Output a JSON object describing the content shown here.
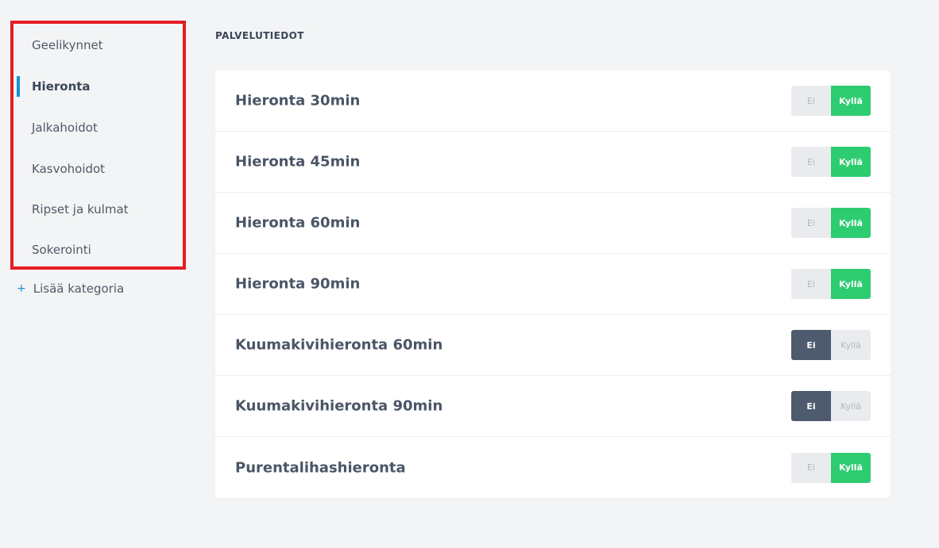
{
  "sidebar": {
    "items": [
      {
        "label": "Geelikynnet",
        "active": false
      },
      {
        "label": "Hieronta",
        "active": true
      },
      {
        "label": "Jalkahoidot",
        "active": false
      },
      {
        "label": "Kasvohoidot",
        "active": false
      },
      {
        "label": "Ripset ja kulmat",
        "active": false
      },
      {
        "label": "Sokerointi",
        "active": false
      }
    ],
    "add_category_label": "Lisää kategoria",
    "add_category_icon": "plus-icon",
    "highlight_color": "#e51c23",
    "active_indicator_color": "#1a90d6"
  },
  "main": {
    "section_title": "PALVELUTIEDOT",
    "toggle_labels": {
      "no": "Ei",
      "yes": "Kyllä"
    },
    "colors": {
      "yes_active": "#2ecc71",
      "no_active": "#4e5a6e",
      "inactive": "#e9ebee"
    },
    "services": [
      {
        "name": "Hieronta 30min",
        "value": "Kyllä"
      },
      {
        "name": "Hieronta 45min",
        "value": "Kyllä"
      },
      {
        "name": "Hieronta 60min",
        "value": "Kyllä"
      },
      {
        "name": "Hieronta 90min",
        "value": "Kyllä"
      },
      {
        "name": "Kuumakivihieronta 60min",
        "value": "Ei"
      },
      {
        "name": "Kuumakivihieronta 90min",
        "value": "Ei"
      },
      {
        "name": "Purentalihashieronta",
        "value": "Kyllä"
      }
    ]
  }
}
